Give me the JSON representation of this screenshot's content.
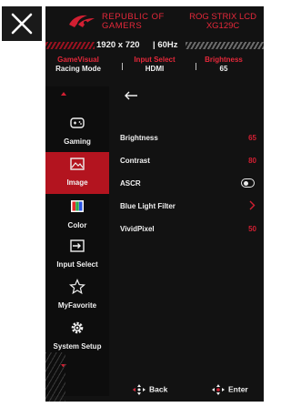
{
  "header": {
    "brand_line1": "REPUBLIC OF",
    "brand_line2": "GAMERS",
    "model_line1": "ROG STRIX LCD",
    "model_line2": "XG129C"
  },
  "signal": {
    "resolution": "1920 x 720",
    "refresh": "60Hz"
  },
  "status": {
    "gamevisual_label": "GameVisual",
    "gamevisual_value": "Racing Mode",
    "input_label": "Input Select",
    "input_value": "HDMI",
    "brightness_label": "Brightness",
    "brightness_value": "65"
  },
  "sidebar": {
    "items": [
      {
        "label": "Gaming"
      },
      {
        "label": "Image"
      },
      {
        "label": "Color"
      },
      {
        "label": "Input Select"
      },
      {
        "label": "MyFavorite"
      },
      {
        "label": "System Setup"
      }
    ],
    "active": "Image"
  },
  "image_menu": {
    "rows": [
      {
        "label": "Brightness",
        "value": "65"
      },
      {
        "label": "Contrast",
        "value": "80"
      },
      {
        "label": "ASCR",
        "value": "",
        "toggle": "off"
      },
      {
        "label": "Blue Light Filter",
        "value": ""
      },
      {
        "label": "VividPixel",
        "value": "50"
      }
    ]
  },
  "footer": {
    "back_label": "Back",
    "enter_label": "Enter"
  },
  "colors": {
    "accent": "#d21f32",
    "active_bg": "#b3141f",
    "panel_bg": "#121212"
  }
}
